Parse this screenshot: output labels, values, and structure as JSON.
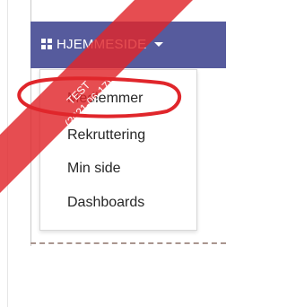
{
  "navbar": {
    "home_label": "HJEMMESIDE",
    "accent": "#565b9d"
  },
  "dropdown": {
    "items": [
      {
        "label": "Medlemmer"
      },
      {
        "label": "Rekruttering"
      },
      {
        "label": "Min side"
      },
      {
        "label": "Dashboards"
      }
    ]
  },
  "ribbon": {
    "line1": "TEST",
    "line2": "(2021-06-17)",
    "color": "#e0262b"
  },
  "annotation": {
    "shape": "oval",
    "color": "#e0262b",
    "target": "Medlemmer"
  },
  "icons": [
    "grid-icon",
    "caret-down-icon"
  ]
}
